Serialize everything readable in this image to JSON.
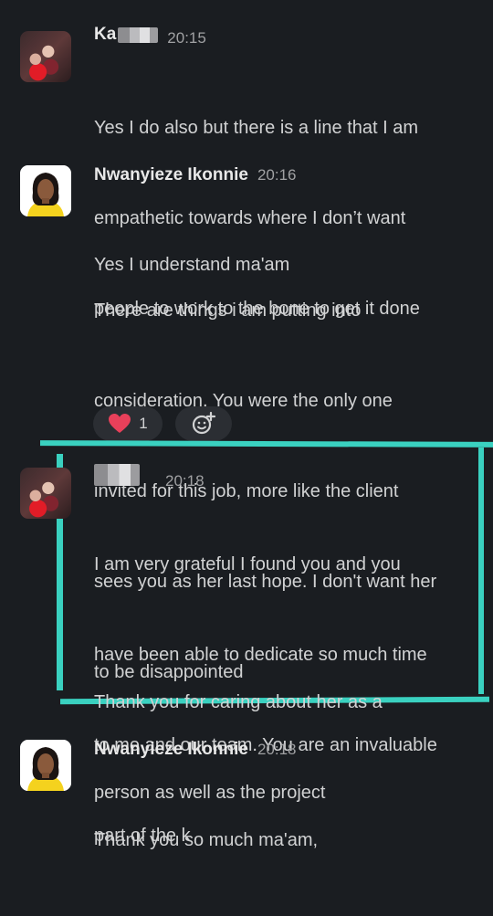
{
  "messages": [
    {
      "sender": "Ka",
      "time": "20:15",
      "lines": [
        "Yes I do also but there is a line that I am",
        "empathetic towards where I don’t want",
        "people to work to the bone to get it done"
      ]
    },
    {
      "sender": "Nwanyieze Ikonnie",
      "time": "20:16",
      "para1": "Yes I understand ma'am",
      "para2_lines": [
        "There are things i am putting into",
        "consideration. You were the only one",
        "invited for this job, more like the client",
        "sees you as her last hope. I don't want her",
        "to be disappointed"
      ],
      "reaction_count": "1"
    },
    {
      "sender": "",
      "time": "20:18",
      "para1_lines": [
        "I am very grateful I found you and you",
        "have been able to dedicate so much time",
        "to me and our team. You are an invaluable",
        "part of the k"
      ],
      "para2_lines": [
        "Thank you for caring about her as a",
        "person as well as the project"
      ]
    },
    {
      "sender": "Nwanyieze Ikonnie",
      "time": "20:18",
      "text": "Thank you so much ma'am,"
    }
  ],
  "icons": {
    "heart": "heart-emoji-icon",
    "add_reaction": "add-reaction-icon"
  },
  "colors": {
    "background": "#1a1d21",
    "highlight": "#3ad1c0",
    "heart": "#e8405a"
  }
}
